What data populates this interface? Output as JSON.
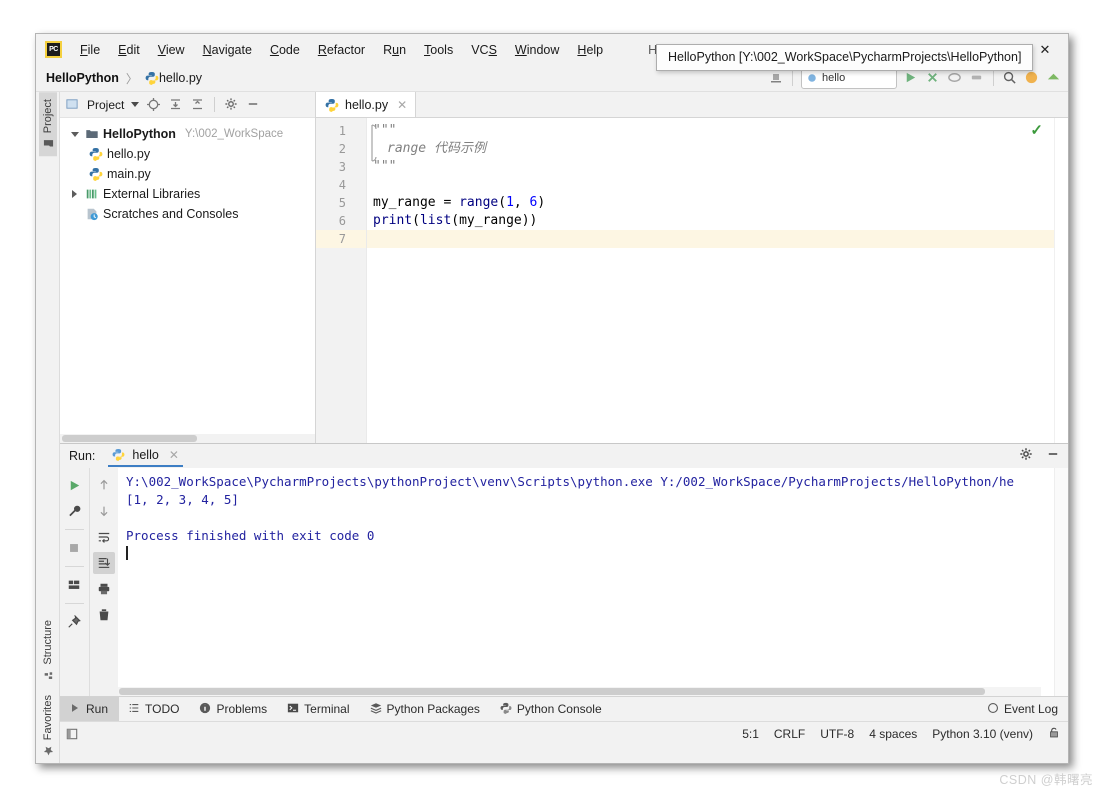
{
  "window": {
    "title": "HelloPython - hello.py",
    "logo_text": "PC",
    "logo_name": "pycharm-logo-icon",
    "minimize": "—",
    "maximize": "□",
    "close": "✕"
  },
  "menu": [
    {
      "label": "File",
      "mnemonic": "F"
    },
    {
      "label": "Edit",
      "mnemonic": "E"
    },
    {
      "label": "View",
      "mnemonic": "V"
    },
    {
      "label": "Navigate",
      "mnemonic": "N"
    },
    {
      "label": "Code",
      "mnemonic": "C"
    },
    {
      "label": "Refactor",
      "mnemonic": "R"
    },
    {
      "label": "Run",
      "mnemonic": "u"
    },
    {
      "label": "Tools",
      "mnemonic": "T"
    },
    {
      "label": "VCS",
      "mnemonic": "S"
    },
    {
      "label": "Window",
      "mnemonic": "W"
    },
    {
      "label": "Help",
      "mnemonic": "H"
    }
  ],
  "navbar": {
    "project": "HelloPython",
    "separator": "〉",
    "file": "hello.py",
    "run_config": "hello"
  },
  "tooltip": {
    "text": "HelloPython [Y:\\002_WorkSpace\\PycharmProjects\\HelloPython]"
  },
  "left_tool_stripe": {
    "top": [
      {
        "label": "Project",
        "icon": "folder-icon"
      }
    ],
    "bottom": [
      {
        "label": "Structure",
        "icon": "structure-icon"
      },
      {
        "label": "Favorites",
        "icon": "star-icon"
      }
    ]
  },
  "project_panel": {
    "title": "Project",
    "tree": [
      {
        "label": "HelloPython",
        "path": "Y:\\002_WorkSpace",
        "indent": 0,
        "twisty": "down",
        "icon": "folder-icon",
        "bold": true
      },
      {
        "label": "hello.py",
        "path": "",
        "indent": 1,
        "twisty": "none",
        "icon": "python-file-icon",
        "bold": false
      },
      {
        "label": "main.py",
        "path": "",
        "indent": 1,
        "twisty": "none",
        "icon": "python-file-icon",
        "bold": false
      },
      {
        "label": "External Libraries",
        "path": "",
        "indent": 0,
        "twisty": "right",
        "icon": "library-icon",
        "bold": false
      },
      {
        "label": "Scratches and Consoles",
        "path": "",
        "indent": 0,
        "twisty": "none",
        "icon": "scratches-icon",
        "bold": false
      }
    ]
  },
  "editor": {
    "tab": {
      "label": "hello.py",
      "close": "✕",
      "icon": "python-file-icon"
    },
    "inspection_status": "✓",
    "lines": [
      {
        "n": "1",
        "fold": "top",
        "segments": [
          {
            "t": "\"\"\"",
            "c": "tok-doc"
          }
        ]
      },
      {
        "n": "2",
        "fold": "",
        "segments": [
          {
            "t": "range 代码示例",
            "c": "tok-doc"
          }
        ]
      },
      {
        "n": "3",
        "fold": "bottom",
        "segments": [
          {
            "t": "\"\"\"",
            "c": "tok-doc"
          }
        ]
      },
      {
        "n": "4",
        "fold": "",
        "segments": []
      },
      {
        "n": "5",
        "fold": "",
        "segments": [
          {
            "t": "my_range = ",
            "c": "tok-var"
          },
          {
            "t": "range",
            "c": "tok-fn"
          },
          {
            "t": "(",
            "c": "tok-var"
          },
          {
            "t": "1",
            "c": "tok-num"
          },
          {
            "t": ", ",
            "c": "tok-var"
          },
          {
            "t": "6",
            "c": "tok-num"
          },
          {
            "t": ")",
            "c": "tok-var"
          }
        ]
      },
      {
        "n": "6",
        "fold": "",
        "segments": [
          {
            "t": "print",
            "c": "tok-fn"
          },
          {
            "t": "(",
            "c": "tok-var"
          },
          {
            "t": "list",
            "c": "tok-fn"
          },
          {
            "t": "(my_range))",
            "c": "tok-var"
          }
        ]
      },
      {
        "n": "7",
        "fold": "",
        "current": true,
        "segments": []
      }
    ]
  },
  "run_panel": {
    "label": "Run:",
    "tab": {
      "label": "hello",
      "close": "✕",
      "icon": "python-run-icon"
    },
    "settings_icon": "gear-icon",
    "hide_icon": "minimize-icon",
    "tool_buttons_left": [
      {
        "name": "rerun-button",
        "icon": "play-icon"
      },
      {
        "name": "edit-configuration-button",
        "icon": "wrench-icon"
      },
      {
        "name": "stop-button",
        "icon": "stop-icon"
      },
      {
        "name": "layout-button",
        "icon": "layout-icon"
      },
      {
        "name": "pin-tab-button",
        "icon": "pin-icon"
      }
    ],
    "tool_buttons_right": [
      {
        "name": "up-button",
        "icon": "arrow-up-icon"
      },
      {
        "name": "down-button",
        "icon": "arrow-down-icon"
      },
      {
        "name": "soft-wrap-button",
        "icon": "wrap-icon"
      },
      {
        "name": "scroll-to-end-button",
        "icon": "scroll-end-icon"
      },
      {
        "name": "print-button",
        "icon": "printer-icon"
      },
      {
        "name": "clear-all-button",
        "icon": "trash-icon"
      }
    ],
    "console": [
      "Y:\\002_WorkSpace\\PycharmProjects\\pythonProject\\venv\\Scripts\\python.exe Y:/002_WorkSpace/PycharmProjects/HelloPython/he",
      "[1, 2, 3, 4, 5]",
      "",
      "Process finished with exit code 0"
    ]
  },
  "tool_window_bar": [
    {
      "label": "Run",
      "icon": "play-icon",
      "active": true
    },
    {
      "label": "TODO",
      "icon": "todo-icon",
      "active": false
    },
    {
      "label": "Problems",
      "icon": "problems-icon",
      "active": false
    },
    {
      "label": "Terminal",
      "icon": "terminal-icon",
      "active": false
    },
    {
      "label": "Python Packages",
      "icon": "packages-icon",
      "active": false
    },
    {
      "label": "Python Console",
      "icon": "python-console-icon",
      "active": false
    }
  ],
  "event_log": {
    "label": "Event Log",
    "icon": "event-log-icon"
  },
  "statusbar": {
    "caret": "5:1",
    "line_separator": "CRLF",
    "encoding": "UTF-8",
    "indent": "4 spaces",
    "interpreter": "Python 3.10 (venv)",
    "lock_icon": "lock-icon"
  },
  "watermark": "CSDN @韩曙亮",
  "colors": {
    "accent_blue": "#3d7ec4",
    "panel_bg": "#f2f2f2",
    "console_text": "#2323a0",
    "ok_green": "#3c9a3c",
    "current_line": "#fdf6e3"
  }
}
